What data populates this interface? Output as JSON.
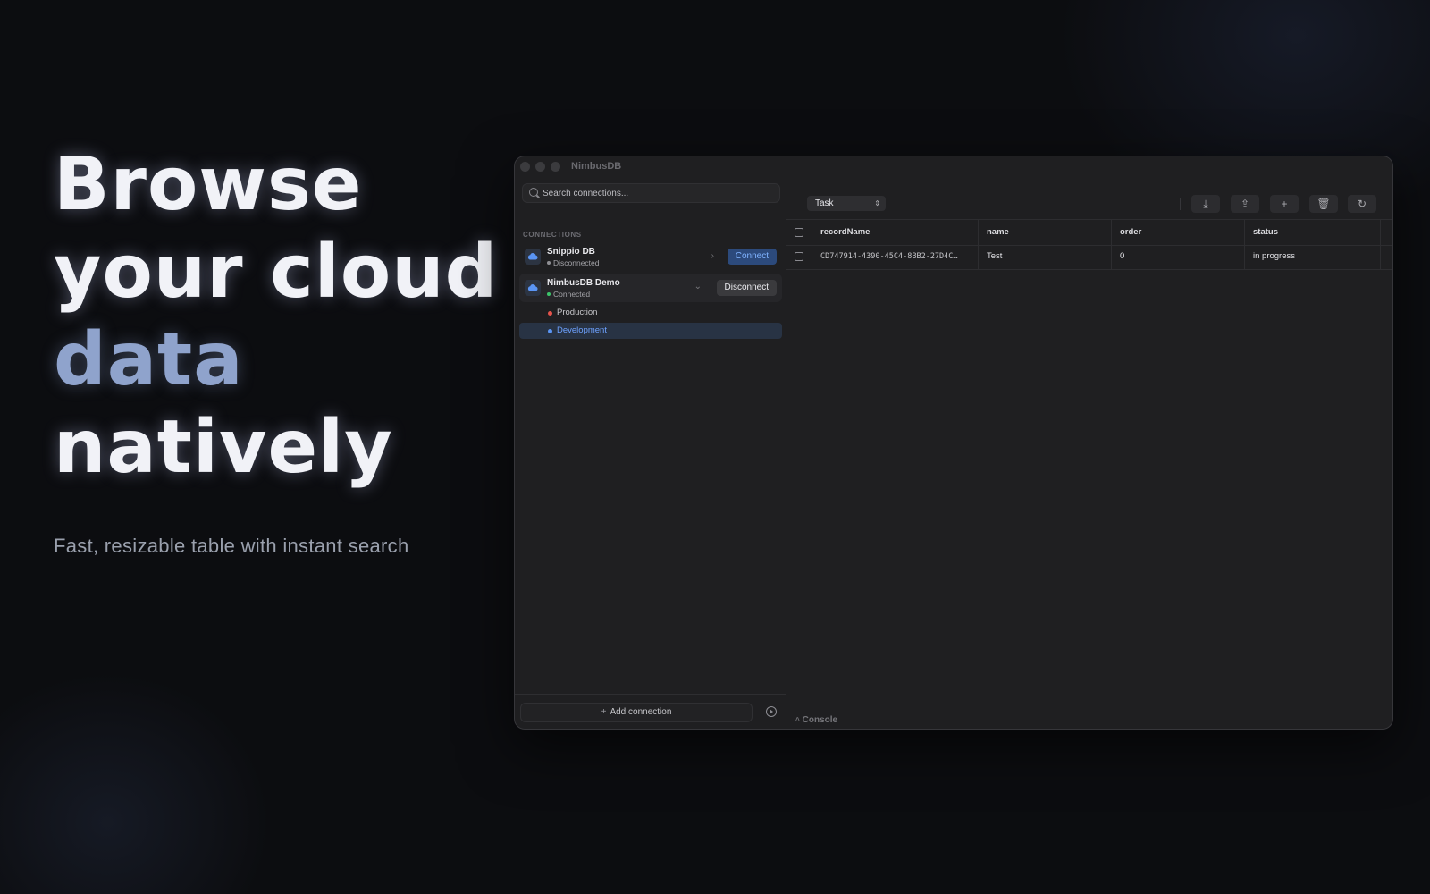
{
  "hero": {
    "line1": "Browse",
    "line2": "your cloud",
    "line3": "data",
    "line4": "natively",
    "subtitle": "Fast, resizable table with instant search"
  },
  "window": {
    "title": "NimbusDB"
  },
  "sidebar": {
    "search_placeholder": "Search connections...",
    "section_title": "CONNECTIONS",
    "connections": [
      {
        "name": "Snippio DB",
        "status": "Disconnected",
        "status_color": "#8e8e93",
        "icon": "cloud-icon",
        "action_label": "Connect",
        "expanded": false
      },
      {
        "name": "NimbusDB Demo",
        "status": "Connected",
        "status_color": "#3cc46a",
        "icon": "cloud-icon",
        "action_label": "Disconnect",
        "expanded": true,
        "environments": [
          {
            "label": "Production",
            "dot_color": "#e5534b"
          },
          {
            "label": "Development",
            "dot_color": "#5a95f5",
            "selected": true
          }
        ]
      }
    ],
    "add_connection_label": "Add connection"
  },
  "main": {
    "entity": "Task",
    "toolbar_icons": [
      "import-icon",
      "export-icon",
      "add-icon",
      "trash-icon",
      "refresh-icon"
    ],
    "columns": [
      "recordName",
      "name",
      "order",
      "status"
    ],
    "rows": [
      [
        "CD747914-4390-45C4-8BB2-27D4C…",
        "Test",
        "0",
        "in progress"
      ]
    ],
    "console_label": "Console"
  },
  "colors": {
    "accent": "#5a95f5",
    "background": "#0c0d10",
    "window": "#1f1f21"
  }
}
